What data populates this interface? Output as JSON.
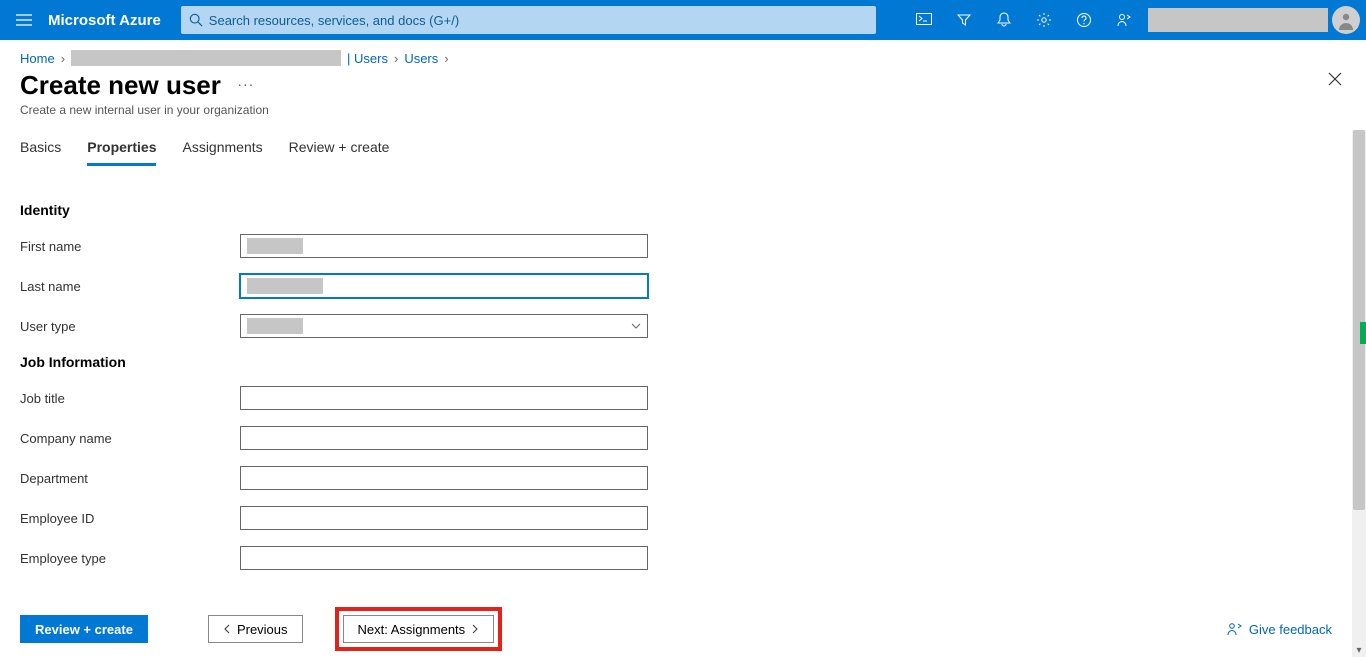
{
  "brand": "Microsoft Azure",
  "search": {
    "placeholder": "Search resources, services, and docs (G+/)"
  },
  "breadcrumbs": {
    "home": "Home",
    "users1": "| Users",
    "users2": "Users"
  },
  "page": {
    "title": "Create new user",
    "subtitle": "Create a new internal user in your organization"
  },
  "tabs": {
    "basics": "Basics",
    "properties": "Properties",
    "assignments": "Assignments",
    "review": "Review + create"
  },
  "sections": {
    "identity": {
      "heading": "Identity",
      "first_name": "First name",
      "last_name": "Last name",
      "user_type": "User type"
    },
    "job": {
      "heading": "Job Information",
      "job_title": "Job title",
      "company_name": "Company name",
      "department": "Department",
      "employee_id": "Employee ID",
      "employee_type": "Employee type"
    }
  },
  "footer": {
    "review": "Review + create",
    "previous": "Previous",
    "next": "Next: Assignments",
    "feedback": "Give feedback"
  }
}
